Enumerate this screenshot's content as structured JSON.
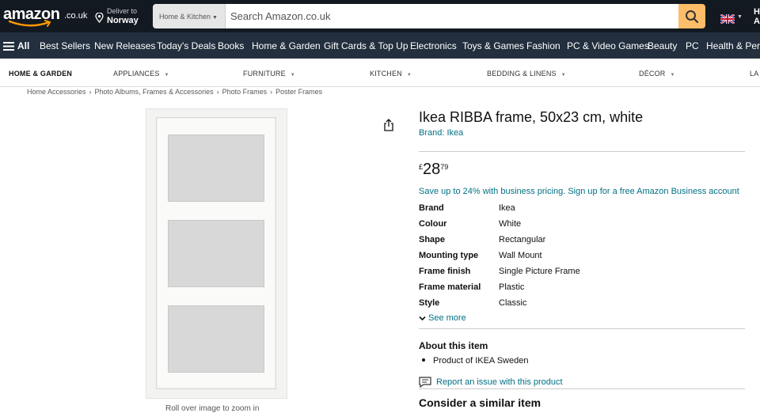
{
  "header": {
    "logo_text": "amazon",
    "logo_tld": ".co.uk",
    "deliver_to_label": "Deliver to",
    "deliver_to_country": "Norway",
    "search_category": "Home & Kitchen",
    "search_placeholder": "Search Amazon.co.uk",
    "account_initials": "H\nA"
  },
  "nav": {
    "all_label": "All",
    "items": [
      "Best Sellers",
      "New Releases",
      "Today's Deals",
      "Books",
      "Home & Garden",
      "Gift Cards & Top Up",
      "Electronics",
      "Toys & Games",
      "Fashion",
      "PC & Video Games",
      "Beauty",
      "PC",
      "Health & Perso"
    ]
  },
  "subnav": {
    "items": [
      "HOME & GARDEN",
      "APPLIANCES",
      "FURNITURE",
      "KITCHEN",
      "BEDDING & LINENS",
      "DÉCOR",
      "LA"
    ]
  },
  "breadcrumb": [
    "Home Accessories",
    "Photo Albums, Frames & Accessories",
    "Photo Frames",
    "Poster Frames"
  ],
  "product": {
    "title": "Ikea RIBBA frame, 50x23 cm, white",
    "brand_link": "Brand: Ikea",
    "price_currency": "£",
    "price_whole": "28",
    "price_fraction": "79",
    "business_pricing": "Save up to 24% with business pricing. Sign up for a free Amazon Business account",
    "specs": [
      {
        "key": "Brand",
        "value": "Ikea"
      },
      {
        "key": "Colour",
        "value": "White"
      },
      {
        "key": "Shape",
        "value": "Rectangular"
      },
      {
        "key": "Mounting type",
        "value": "Wall Mount"
      },
      {
        "key": "Frame finish",
        "value": "Single Picture Frame"
      },
      {
        "key": "Frame material",
        "value": "Plastic"
      },
      {
        "key": "Style",
        "value": "Classic"
      }
    ],
    "see_more": "See more",
    "about_heading": "About this item",
    "about_bullets": [
      "Product of IKEA Sweden"
    ],
    "report_issue": "Report an issue with this product",
    "similar_heading": "Consider a similar item",
    "zoom_hint": "Roll over image to zoom in"
  },
  "colors": {
    "top_bg": "#131921",
    "nav_bg": "#232f3e",
    "search_button": "#febd69",
    "link": "#007185"
  }
}
